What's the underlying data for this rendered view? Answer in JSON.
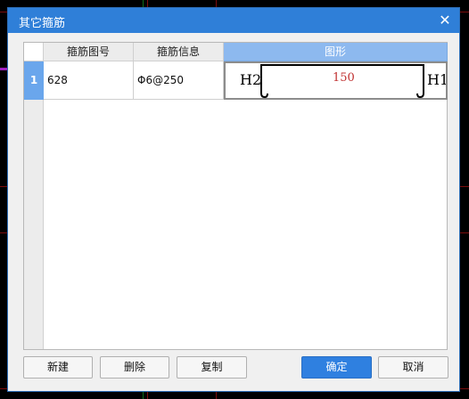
{
  "dialog": {
    "title": "其它箍筋",
    "close_glyph": "✕"
  },
  "table": {
    "columns": [
      {
        "label": "箍筋图号"
      },
      {
        "label": "箍筋信息"
      },
      {
        "label": "图形"
      }
    ],
    "rows": [
      {
        "index": "1",
        "figure_no": "628",
        "info": "Φ6@250",
        "shape": {
          "left_label": "H2",
          "right_label": "H1",
          "dimension": "150"
        }
      }
    ]
  },
  "buttons": {
    "new": "新建",
    "delete": "删除",
    "copy": "复制",
    "ok": "确定",
    "cancel": "取消"
  },
  "colors": {
    "title_bar": "#2f7fd8",
    "primary_button": "#2f80e0",
    "active_header": "#8db9ef",
    "dimension_text": "#c03030"
  }
}
